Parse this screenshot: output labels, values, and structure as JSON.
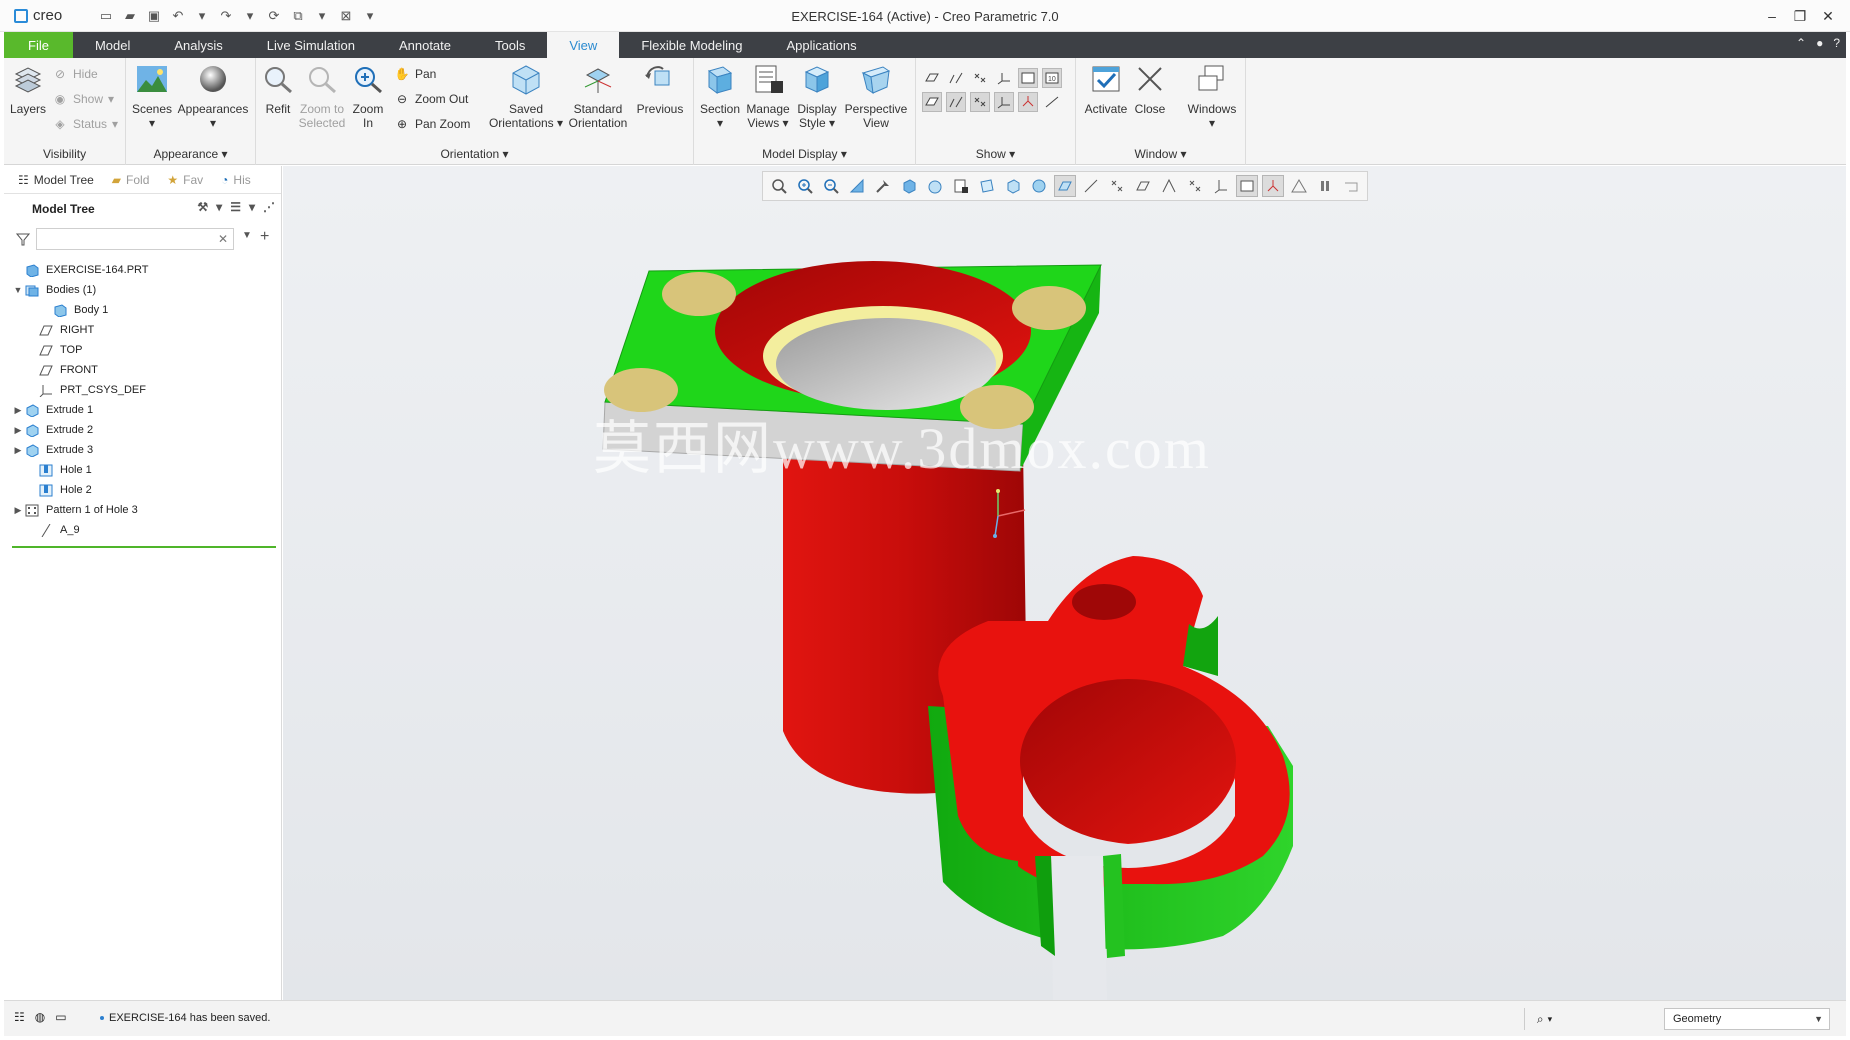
{
  "app": {
    "logo_text": "creo",
    "window_title": "EXERCISE-164 (Active) - Creo Parametric 7.0"
  },
  "tabs": [
    {
      "label": "File"
    },
    {
      "label": "Model"
    },
    {
      "label": "Analysis"
    },
    {
      "label": "Live Simulation"
    },
    {
      "label": "Annotate"
    },
    {
      "label": "Tools"
    },
    {
      "label": "View"
    },
    {
      "label": "Flexible Modeling"
    },
    {
      "label": "Applications"
    }
  ],
  "ribbon": {
    "visibility": {
      "label": "Visibility",
      "layers": "Layers",
      "hide": "Hide",
      "show": "Show",
      "status": "Status"
    },
    "appearance": {
      "label": "Appearance",
      "scenes": "Scenes",
      "appearances": "Appearances"
    },
    "orientation": {
      "label": "Orientation",
      "refit": "Refit",
      "zoom_to_selected_1": "Zoom to",
      "zoom_to_selected_2": "Selected",
      "zoom_in_1": "Zoom",
      "zoom_in_2": "In",
      "pan": "Pan",
      "zoom_out": "Zoom Out",
      "pan_zoom": "Pan Zoom",
      "saved_orientations_1": "Saved",
      "saved_orientations_2": "Orientations",
      "standard_orientation_1": "Standard",
      "standard_orientation_2": "Orientation",
      "previous": "Previous"
    },
    "model_display": {
      "label": "Model Display",
      "section": "Section",
      "manage_views_1": "Manage",
      "manage_views_2": "Views",
      "display_style_1": "Display",
      "display_style_2": "Style",
      "perspective_view_1": "Perspective",
      "perspective_view_2": "View"
    },
    "show": {
      "label": "Show"
    },
    "window": {
      "label": "Window",
      "activate": "Activate",
      "close": "Close",
      "windows": "Windows"
    }
  },
  "navigator": {
    "tabs": [
      {
        "label": "Model Tree"
      },
      {
        "label": "Fold"
      },
      {
        "label": "Fav"
      },
      {
        "label": "His"
      }
    ],
    "tree_title": "Model Tree",
    "search_value": "",
    "items": [
      {
        "label": "EXERCISE-164.PRT",
        "icon": "part-icon",
        "expander": ""
      },
      {
        "label": "Bodies (1)",
        "icon": "bodies-icon",
        "expander": "▼"
      },
      {
        "label": "Body 1",
        "icon": "body-icon",
        "expander": ""
      },
      {
        "label": "RIGHT",
        "icon": "datum-plane-icon",
        "expander": ""
      },
      {
        "label": "TOP",
        "icon": "datum-plane-icon",
        "expander": ""
      },
      {
        "label": "FRONT",
        "icon": "datum-plane-icon",
        "expander": ""
      },
      {
        "label": "PRT_CSYS_DEF",
        "icon": "csys-icon",
        "expander": ""
      },
      {
        "label": "Extrude 1",
        "icon": "extrude-icon",
        "expander": "▶"
      },
      {
        "label": "Extrude 2",
        "icon": "extrude-icon",
        "expander": "▶"
      },
      {
        "label": "Extrude 3",
        "icon": "extrude-icon",
        "expander": "▶"
      },
      {
        "label": "Hole 1",
        "icon": "hole-icon",
        "expander": ""
      },
      {
        "label": "Hole 2",
        "icon": "hole-icon",
        "expander": ""
      },
      {
        "label": "Pattern 1 of Hole 3",
        "icon": "pattern-icon",
        "expander": "▶"
      },
      {
        "label": "A_9",
        "icon": "axis-icon",
        "expander": ""
      }
    ]
  },
  "graphics": {
    "watermark": "莫西网www.3dmox.com"
  },
  "status": {
    "message": "EXERCISE-164 has been saved.",
    "selection_filter": "Geometry"
  },
  "colors": {
    "file_tab": "#59b92c",
    "active_tab_text": "#2c8bd0",
    "model_green": "#1fd61a",
    "model_red": "#e8120e",
    "hole_tan": "#d8c47a"
  }
}
